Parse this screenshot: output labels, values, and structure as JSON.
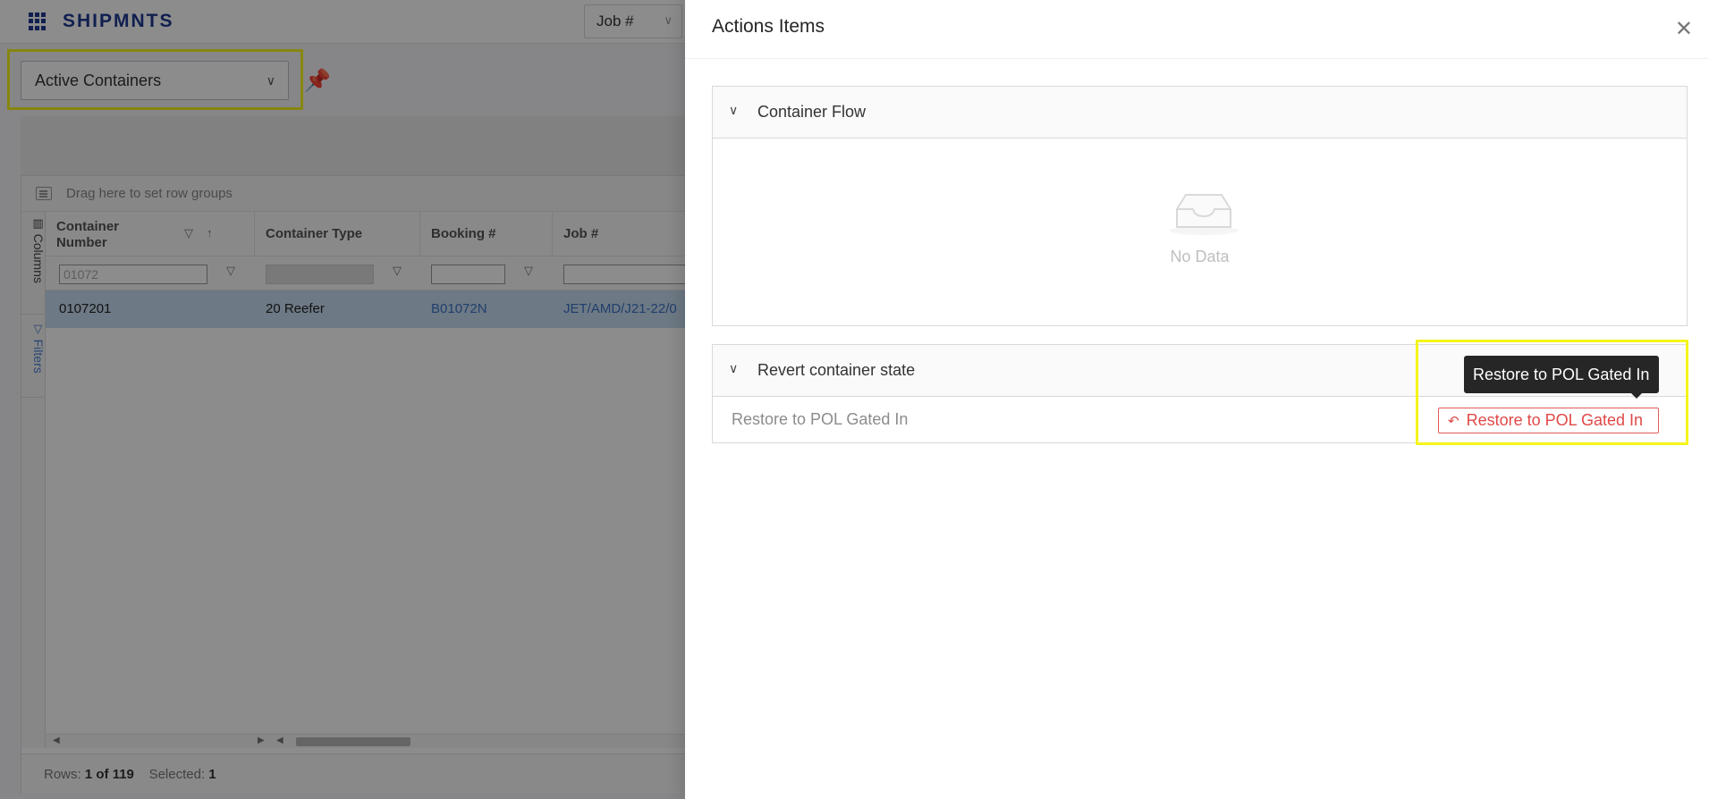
{
  "app": {
    "brand": "SHIPMNTS",
    "job_search": {
      "label": "Job #"
    }
  },
  "view": {
    "selected": "Active Containers"
  },
  "grid": {
    "drag_hint": "Drag here to set row groups",
    "side_tabs": {
      "columns": "Columns",
      "filters": "Filters"
    },
    "headers": {
      "container_number": "Container Number",
      "container_type": "Container Type",
      "booking": "Booking #",
      "job": "Job #"
    },
    "filters": {
      "container_number": "01072"
    },
    "row": {
      "container_number": "0107201",
      "container_type": "20 Reefer",
      "booking": "B01072N",
      "job": "JET/AMD/J21-22/0"
    },
    "status": {
      "rows_label": "Rows:",
      "rows_value": "1 of 119",
      "selected_label": "Selected:",
      "selected_value": "1"
    }
  },
  "drawer": {
    "title": "Actions Items",
    "container_flow": {
      "title": "Container Flow",
      "empty_text": "No Data"
    },
    "revert": {
      "title": "Revert container state",
      "row_label": "Restore to POL Gated In",
      "button_label": "Restore to POL Gated In",
      "tooltip": "Restore to POL Gated In"
    }
  },
  "colors": {
    "brand": "#1f3a93",
    "danger": "#e04848",
    "highlight": "#f5f51a",
    "selected_row": "#c6dcf1"
  }
}
